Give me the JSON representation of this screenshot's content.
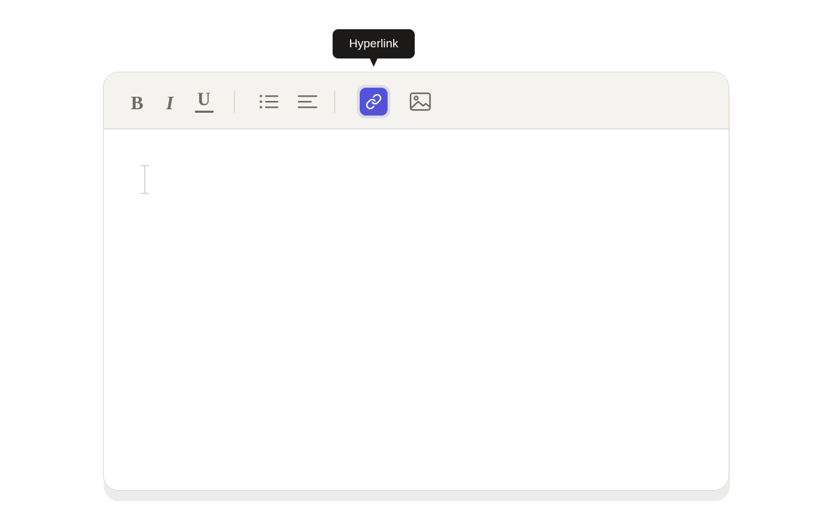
{
  "toolbar": {
    "bold_label": "B",
    "italic_label": "I",
    "underline_label": "U",
    "icons": [
      "bulleted-list-icon",
      "align-left-icon",
      "link-icon",
      "image-icon"
    ],
    "active_tool": "hyperlink",
    "accent_color": "#5353d9"
  },
  "tooltip": {
    "text": "Hyperlink"
  }
}
